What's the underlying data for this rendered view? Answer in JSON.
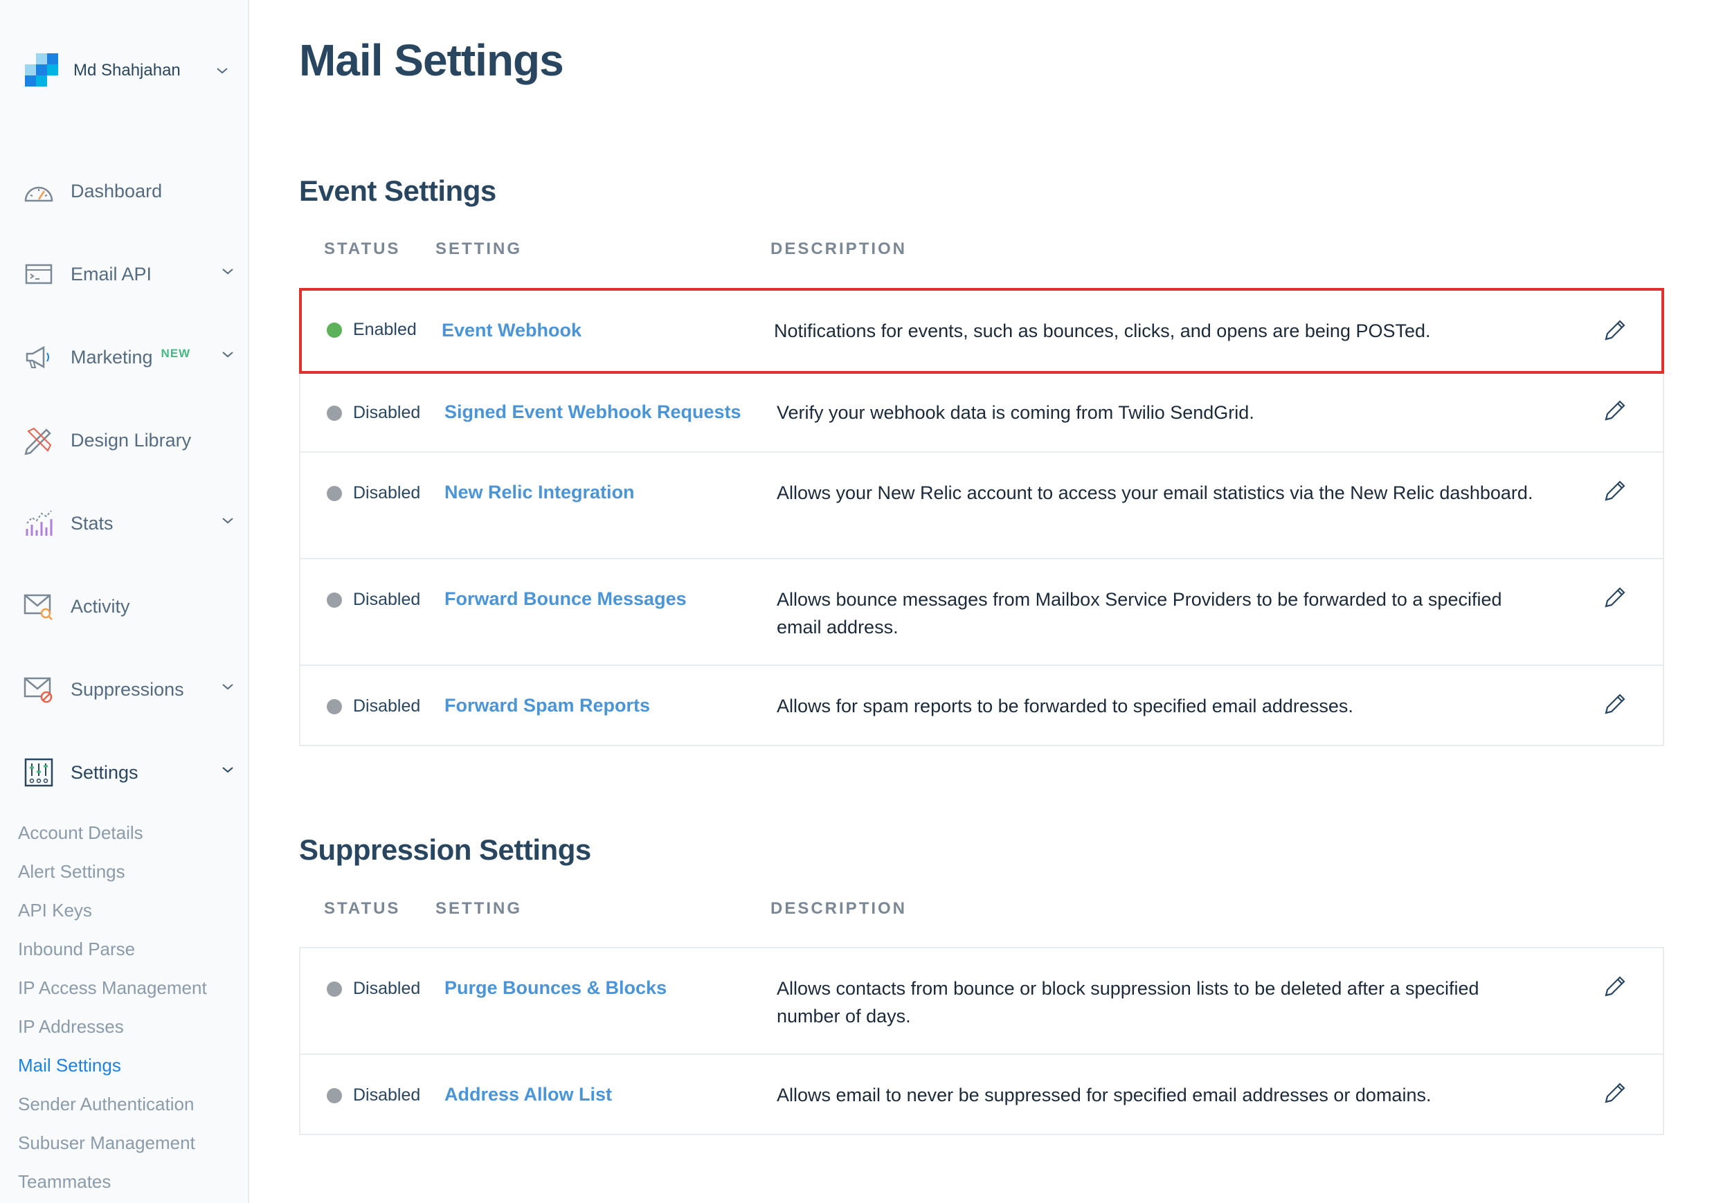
{
  "account": {
    "name": "Md Shahjahan"
  },
  "sidebar": {
    "nav": [
      {
        "label": "Dashboard",
        "icon": "dashboard-icon"
      },
      {
        "label": "Email API",
        "icon": "email-api-icon",
        "expandable": true
      },
      {
        "label": "Marketing",
        "icon": "megaphone-icon",
        "badge": "NEW",
        "expandable": true
      },
      {
        "label": "Design Library",
        "icon": "design-library-icon"
      },
      {
        "label": "Stats",
        "icon": "stats-icon",
        "expandable": true
      },
      {
        "label": "Activity",
        "icon": "activity-icon"
      },
      {
        "label": "Suppressions",
        "icon": "suppressions-icon",
        "expandable": true
      },
      {
        "label": "Settings",
        "icon": "settings-icon",
        "expandable": true,
        "active": true
      }
    ],
    "settings_sub": [
      {
        "label": "Account Details"
      },
      {
        "label": "Alert Settings"
      },
      {
        "label": "API Keys"
      },
      {
        "label": "Inbound Parse"
      },
      {
        "label": "IP Access Management"
      },
      {
        "label": "IP Addresses"
      },
      {
        "label": "Mail Settings",
        "active": true
      },
      {
        "label": "Sender Authentication"
      },
      {
        "label": "Subuser Management"
      },
      {
        "label": "Teammates"
      }
    ]
  },
  "page": {
    "title": "Mail Settings"
  },
  "columns": {
    "status": "STATUS",
    "setting": "SETTING",
    "description": "DESCRIPTION"
  },
  "event_settings": {
    "title": "Event Settings",
    "rows": [
      {
        "status": "Enabled",
        "setting": "Event Webhook",
        "description": "Notifications for events, such as bounces, clicks, and opens are being POSTed.",
        "highlighted": true
      },
      {
        "status": "Disabled",
        "setting": "Signed Event Webhook Requests",
        "description": "Verify your webhook data is coming from Twilio SendGrid."
      },
      {
        "status": "Disabled",
        "setting": "New Relic Integration",
        "description": "Allows your New Relic account to access your email statistics via the New Relic dashboard."
      },
      {
        "status": "Disabled",
        "setting": "Forward Bounce Messages",
        "description": "Allows bounce messages from Mailbox Service Providers to be forwarded to a specified email address."
      },
      {
        "status": "Disabled",
        "setting": "Forward Spam Reports",
        "description": "Allows for spam reports to be forwarded to specified email addresses."
      }
    ]
  },
  "suppression_settings": {
    "title": "Suppression Settings",
    "rows": [
      {
        "status": "Disabled",
        "setting": "Purge Bounces & Blocks",
        "description": "Allows contacts from bounce or block suppression lists to be deleted after a specified number of days."
      },
      {
        "status": "Disabled",
        "setting": "Address Allow List",
        "description": "Allows email to never be suppressed for specified email addresses or domains."
      }
    ]
  },
  "colors": {
    "enabled_dot": "#5db158",
    "disabled_dot": "#9aa0a6",
    "link": "#4a94d8",
    "highlight_border": "#e0312f",
    "active_sub": "#1a82e2"
  }
}
